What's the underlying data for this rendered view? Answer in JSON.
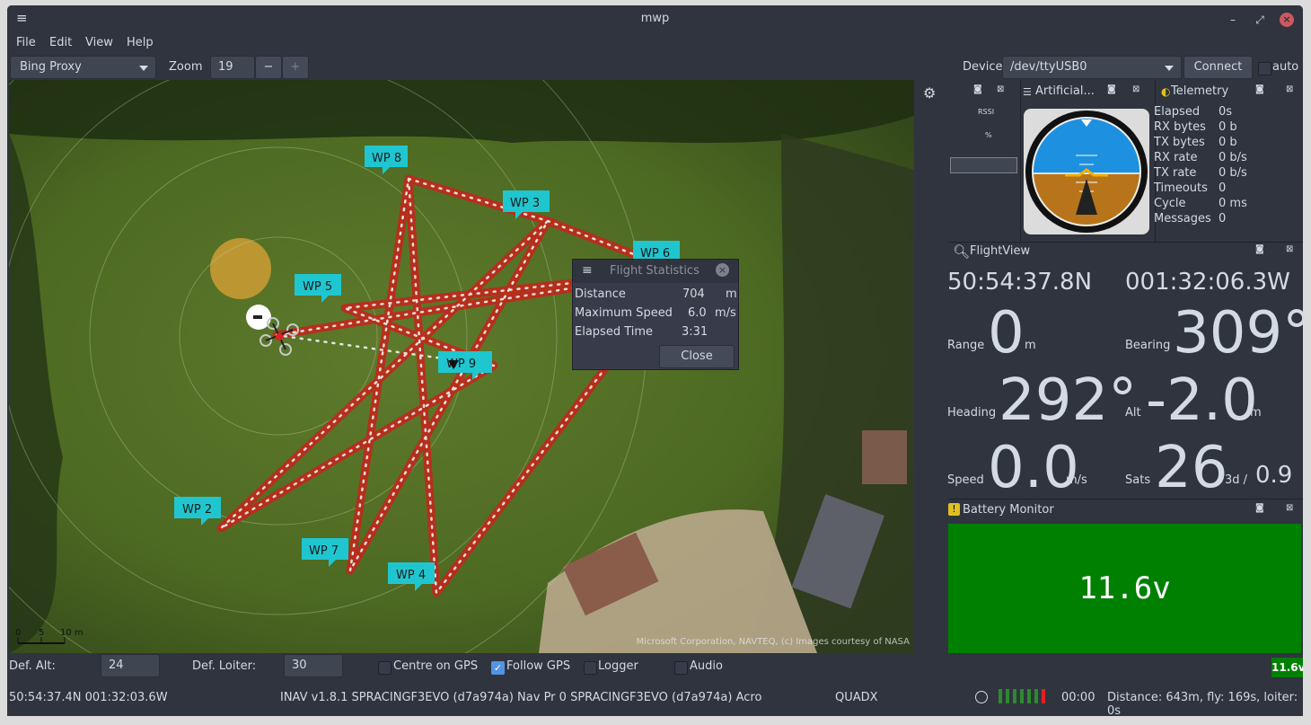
{
  "window": {
    "title": "mwp"
  },
  "menu": [
    "File",
    "Edit",
    "View",
    "Help"
  ],
  "toolbar": {
    "map_source": "Bing Proxy",
    "zoom_label": "Zoom",
    "zoom_value": "19",
    "zoom_minus": "−",
    "zoom_plus": "+",
    "device_label": "Device",
    "device_value": "/dev/ttyUSB0",
    "connect_label": "Connect",
    "auto_label": "auto"
  },
  "map": {
    "waypoints": [
      "WP 8",
      "WP 3",
      "WP 6",
      "WP 5",
      "WP 9",
      "WP 2",
      "WP 7",
      "WP 4"
    ],
    "scale": {
      "zero": "0",
      "five": "5",
      "ten": "10 m"
    },
    "attribution": "Microsoft Corporation, NAVTEQ, (c) Images courtesy of NASA"
  },
  "flight_stats": {
    "title": "Flight Statistics",
    "rows": [
      {
        "label": "Distance",
        "value": "704",
        "unit": "m"
      },
      {
        "label": "Maximum Speed",
        "value": "6.0",
        "unit": "m/s"
      },
      {
        "label": "Elapsed Time",
        "value": "3:31",
        "unit": ""
      }
    ],
    "close_label": "Close"
  },
  "rssi": {
    "label": "RSSI",
    "unit": "%"
  },
  "horizon": {
    "title": "Artificial..."
  },
  "telemetry": {
    "title": "Telemetry",
    "rows": [
      {
        "label": "Elapsed",
        "value": "0s"
      },
      {
        "label": "RX bytes",
        "value": "0 b"
      },
      {
        "label": "TX bytes",
        "value": "0 b"
      },
      {
        "label": "RX rate",
        "value": "0 b/s"
      },
      {
        "label": "TX rate",
        "value": "0 b/s"
      },
      {
        "label": "Timeouts",
        "value": "0"
      },
      {
        "label": "Cycle",
        "value": "0 ms"
      },
      {
        "label": "Messages",
        "value": "0"
      }
    ]
  },
  "flightview": {
    "title": "FlightView",
    "lat": "50:54:37.8N",
    "lon": "001:32:06.3W",
    "range_label": "Range",
    "range": "0",
    "range_unit": "m",
    "bearing_label": "Bearing",
    "bearing": "309°",
    "heading_label": "Heading",
    "heading": "292°",
    "alt_label": "Alt",
    "alt": "-2.0",
    "alt_unit": "m",
    "speed_label": "Speed",
    "speed": "0.0",
    "speed_unit": "m/s",
    "sats_label": "Sats",
    "sats": "26",
    "sats_fix": "3d /",
    "hdop": "0.9"
  },
  "battery": {
    "title": "Battery Monitor",
    "voltage": "11.6v",
    "status_voltage": "11.6v",
    "color": "#008000"
  },
  "bottom": {
    "def_alt_label": "Def. Alt:",
    "def_alt": "24",
    "def_loiter_label": "Def. Loiter:",
    "def_loiter": "30",
    "centre_gps": "Centre on GPS",
    "follow_gps": "Follow GPS",
    "logger": "Logger",
    "audio": "Audio",
    "position": "50:54:37.4N 001:32:03.6W",
    "fc_info": "INAV v1.8.1 SPRACINGF3EVO (d7a974a) Nav Pr 0 SPRACINGF3EVO (d7a974a) Acro",
    "frame": "QUADX",
    "timer": "00:00",
    "summary": "Distance: 643m, fly: 169s, loiter: 0s"
  }
}
